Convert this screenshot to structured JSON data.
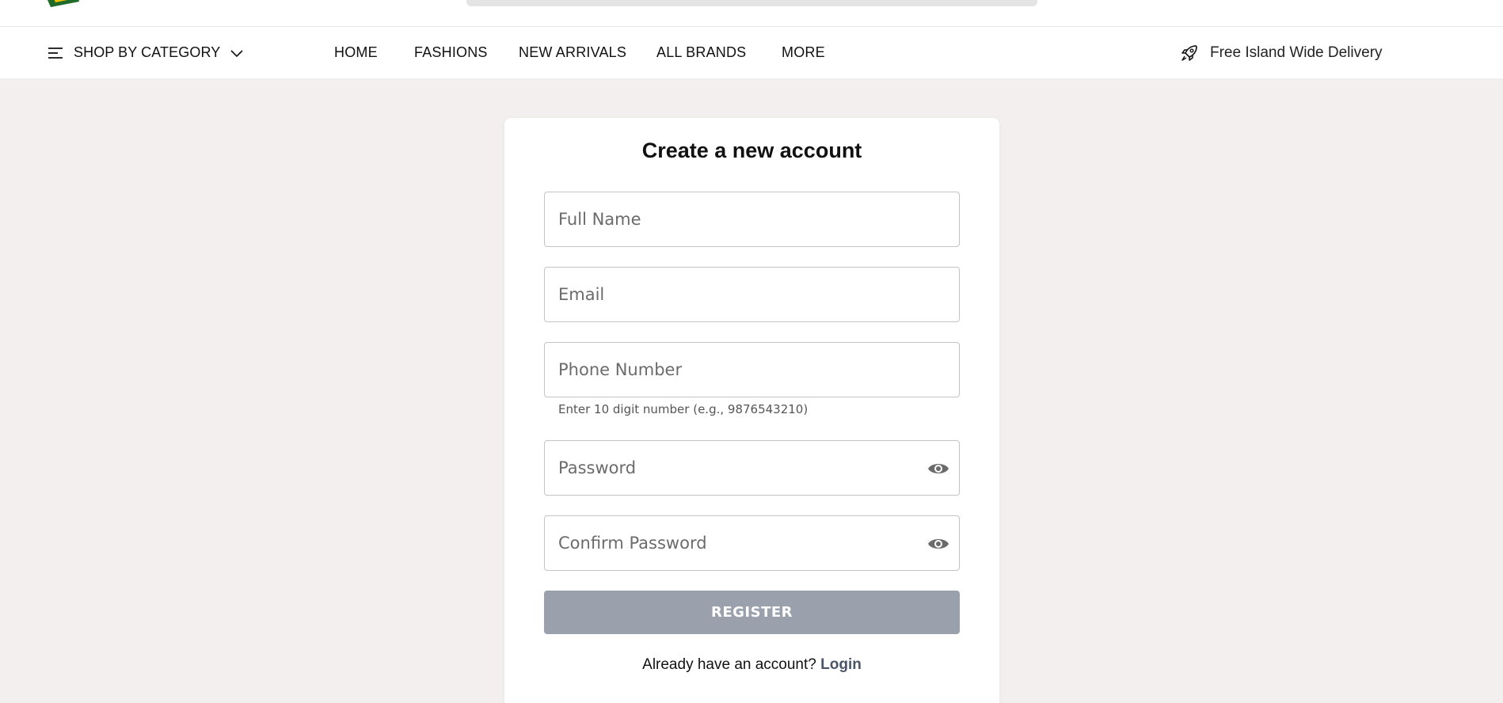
{
  "brand": {
    "accent": "#1f6b2a",
    "logo_icon": "store-logo"
  },
  "nav": {
    "category_label": "SHOP BY CATEGORY",
    "links": [
      "HOME",
      "FASHIONS",
      "NEW ARRIVALS",
      "ALL BRANDS",
      "MORE"
    ],
    "delivery_text": "Free Island Wide Delivery"
  },
  "form": {
    "title": "Create a new account",
    "full_name_placeholder": "Full Name",
    "email_placeholder": "Email",
    "phone_placeholder": "Phone Number",
    "phone_helper": "Enter 10 digit number (e.g., 9876543210)",
    "password_placeholder": "Password",
    "confirm_password_placeholder": "Confirm Password",
    "register_label": "REGISTER",
    "have_account_text": "Already have an account?",
    "login_label": "Login"
  },
  "colors": {
    "page_bg": "#f3efee",
    "button_disabled": "#9aa1ad",
    "link": "#4a5568"
  }
}
